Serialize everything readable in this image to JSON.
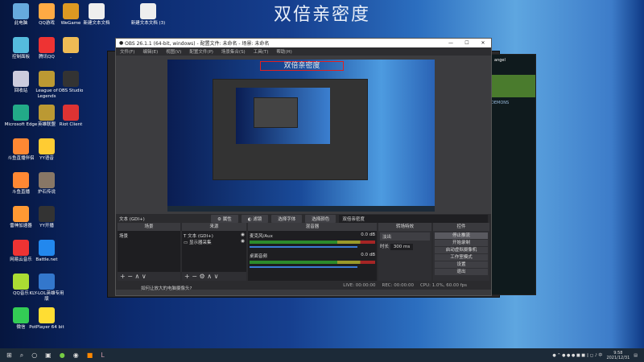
{
  "overlay_title": "双倍亲密度",
  "desktop_icons": [
    "此电脑",
    "QQ游戏",
    "WeGame",
    "新建文本文档",
    "新建文本文档 (3)",
    "控制面板",
    "腾讯QQ",
    ".",
    "回收站",
    "League of Legends",
    "OBS Studio",
    "Microsoft Edge",
    "英雄联盟",
    "Riot Client",
    "斗鱼直播伴侣",
    "YY语音",
    "斗鱼直播",
    "炉石传说",
    "雷神加速器",
    "YY开播",
    "网易云音乐",
    "Battle.net",
    "QQ音乐",
    "KLY-LOL英雄专用版",
    "微信",
    "PotPlayer 64 bit"
  ],
  "obs": {
    "title": "OBS 26.1.1 (64-bit, windows) - 配置文件: 未命名 - 场景: 未命名",
    "menu": [
      "文件(F)",
      "编辑(E)",
      "视图(V)",
      "配置文件(P)",
      "场景集合(S)",
      "工具(T)",
      "帮助(H)"
    ],
    "canvas_text": "双倍亲密度",
    "toolbar": {
      "source": "文本 (GDI+)",
      "properties": "属性",
      "filters": "滤镜",
      "font": "选择字体",
      "color": "选择颜色",
      "text_value": "双倍亲密度"
    },
    "docks": {
      "scenes": "场景",
      "sources": "来源",
      "mixer": "混音器",
      "transitions": "转场特效",
      "controls": "控件"
    },
    "scenes": [
      "场景"
    ],
    "sources": [
      "文本 (GDI+)",
      "显示器采集"
    ],
    "mixer": [
      {
        "name": "麦克风/Aux",
        "db": "0.0 dB"
      },
      {
        "name": "桌面音频",
        "db": "0.0 dB"
      }
    ],
    "transition": {
      "type": "淡出",
      "duration_label": "时长",
      "duration": "300 ms"
    },
    "controls": [
      "停止推流",
      "开始录制",
      "启动虚拟摄像机",
      "工作室模式",
      "设置",
      "退出"
    ],
    "status": {
      "live": "LIVE: 00:00:00",
      "rec": "REC: 00:00:00",
      "cpu": "CPU: 1.0%, 60.00 fps"
    }
  },
  "green_app": {
    "user": "angel",
    "label": "DEMONS"
  },
  "popup": "如何让放大的电脑摄像头?",
  "taskbar": {
    "time": "9:58",
    "date": "2021/12/31"
  }
}
